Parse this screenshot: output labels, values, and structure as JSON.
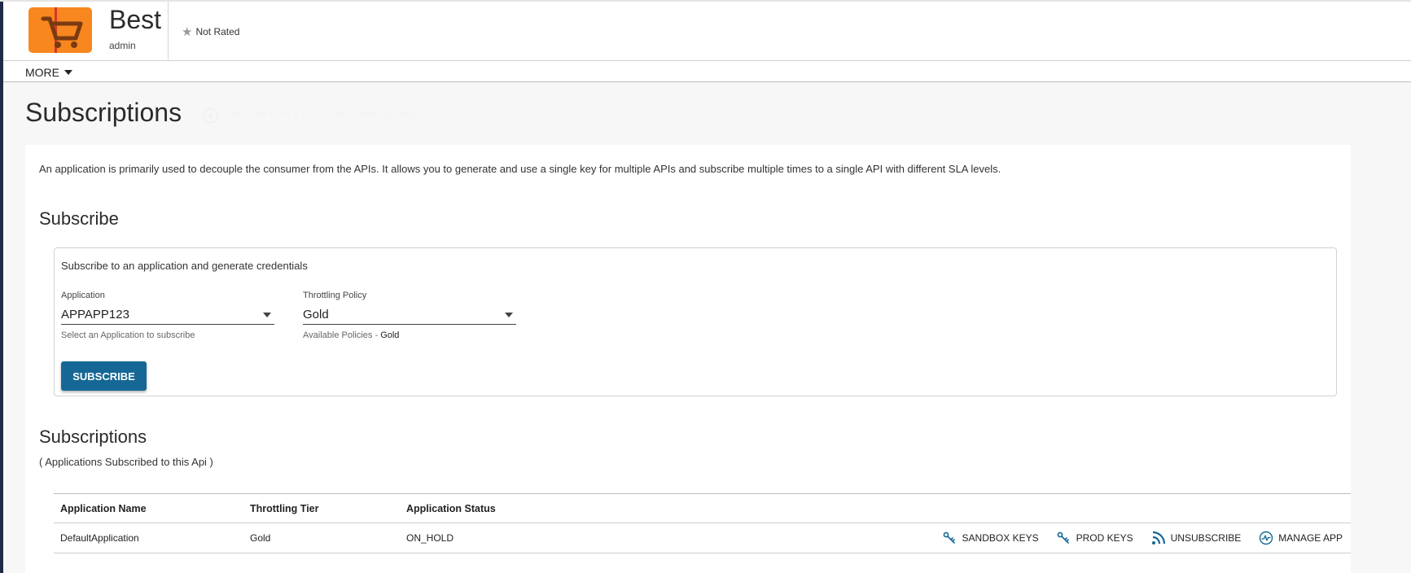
{
  "header": {
    "api_name": "Best",
    "owner": "admin",
    "rating": "Not Rated",
    "thumbnail_color": "#f7871e"
  },
  "nav": {
    "more_label": "MORE"
  },
  "page": {
    "title": "Subscriptions",
    "wizard_label": "SUBSCRIPTION & KEY GENERATION WIZARD"
  },
  "intro": "An application is primarily used to decouple the consumer from the APIs. It allows you to generate and use a single key for multiple APIs and subscribe multiple times to a single API with different SLA levels.",
  "subscribe": {
    "heading": "Subscribe",
    "box_title": "Subscribe to an application and generate credentials",
    "application": {
      "label": "Application",
      "value": "APPAPP123",
      "helper": "Select an Application to subscribe"
    },
    "throttling": {
      "label": "Throttling Policy",
      "value": "Gold",
      "helper_prefix": "Available Policies -",
      "helper_value": "Gold"
    },
    "button_label": "SUBSCRIBE",
    "button_color": "#156895"
  },
  "subscriptions": {
    "heading": "Subscriptions",
    "subtitle": "( Applications Subscribed to this Api )",
    "columns": [
      "Application Name",
      "Throttling Tier",
      "Application Status"
    ],
    "rows": [
      {
        "app_name": "DefaultApplication",
        "tier": "Gold",
        "status": "ON_HOLD"
      }
    ],
    "actions": {
      "sandbox": "SANDBOX KEYS",
      "prod": "PROD KEYS",
      "unsubscribe": "UNSUBSCRIBE",
      "manage": "MANAGE APP"
    },
    "icon_color": "#156895"
  }
}
